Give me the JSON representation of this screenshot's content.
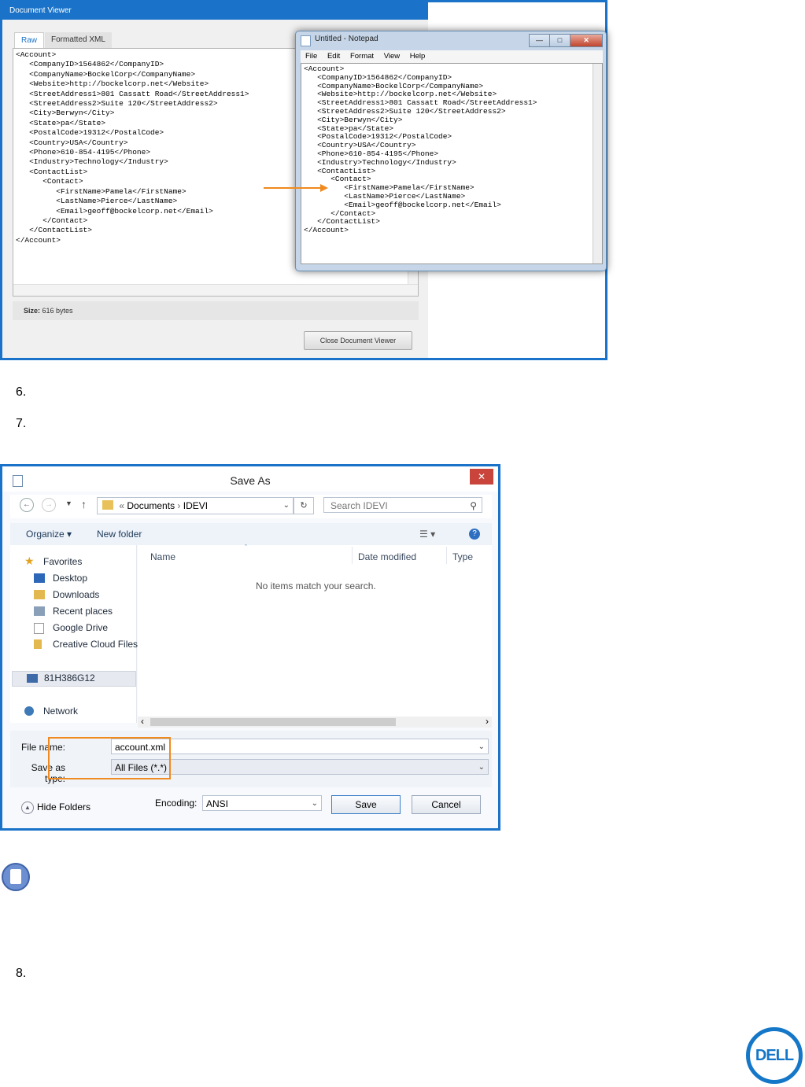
{
  "figure1": {
    "doc_viewer": {
      "title": "Document Viewer",
      "tabs": [
        "Raw",
        "Formatted XML"
      ],
      "xml_lines": "<Account>\n   <CompanyID>1564862</CompanyID>\n   <CompanyName>BockelCorp</CompanyName>\n   <Website>http://bockelcorp.net</Website>\n   <StreetAddress1>801 Cassatt Road</StreetAddress1>\n   <StreetAddress2>Suite 120</StreetAddress2>\n   <City>Berwyn</City>\n   <State>pa</State>\n   <PostalCode>19312</PostalCode>\n   <Country>USA</Country>\n   <Phone>610-854-4195</Phone>\n   <Industry>Technology</Industry>\n   <ContactList>\n      <Contact>\n         <FirstName>Pamela</FirstName>\n         <LastName>Pierce</LastName>\n         <Email>geoff@bockelcorp.net</Email>\n      </Contact>\n   </ContactList>\n</Account>",
      "size_label": "Size:",
      "size_value": "616 bytes",
      "close_button": "Close Document Viewer"
    },
    "notepad": {
      "title": "Untitled - Notepad",
      "menu": [
        "File",
        "Edit",
        "Format",
        "View",
        "Help"
      ],
      "xml_lines": "<Account>\n   <CompanyID>1564862</CompanyID>\n   <CompanyName>BockelCorp</CompanyName>\n   <Website>http://bockelcorp.net</Website>\n   <StreetAddress1>801 Cassatt Road</StreetAddress1>\n   <StreetAddress2>Suite 120</StreetAddress2>\n   <City>Berwyn</City>\n   <State>pa</State>\n   <PostalCode>19312</PostalCode>\n   <Country>USA</Country>\n   <Phone>610-854-4195</Phone>\n   <Industry>Technology</Industry>\n   <ContactList>\n      <Contact>\n         <FirstName>Pamela</FirstName>\n         <LastName>Pierce</LastName>\n         <Email>geoff@bockelcorp.net</Email>\n      </Contact>\n   </ContactList>\n</Account>"
    }
  },
  "steps": [
    "6.",
    "7.",
    "8."
  ],
  "save_as": {
    "title": "Save As",
    "path": [
      "«",
      "Documents",
      "›",
      "IDEVI"
    ],
    "search_placeholder": "Search IDEVI",
    "toolbar": {
      "organize": "Organize ▾",
      "new_folder": "New folder"
    },
    "favorites_header": "Favorites",
    "favorites": [
      "Desktop",
      "Downloads",
      "Recent places",
      "Google Drive",
      "Creative Cloud Files"
    ],
    "computer": "81H386G12",
    "network": "Network",
    "columns": [
      "Name",
      "Date modified",
      "Type"
    ],
    "empty_message": "No items match your search.",
    "file_name_label": "File name:",
    "file_name_value": "account.xml",
    "save_type_label": "Save as type:",
    "save_type_value": "All Files  (*.*)",
    "hide_folders": "Hide Folders",
    "encoding_label": "Encoding:",
    "encoding_value": "ANSI",
    "save_button": "Save",
    "cancel_button": "Cancel"
  },
  "logo": "DELL",
  "colors": {
    "frame_blue": "#1a73c8",
    "highlight_orange": "#f08a1e",
    "arrow_orange": "#f08a1e"
  }
}
